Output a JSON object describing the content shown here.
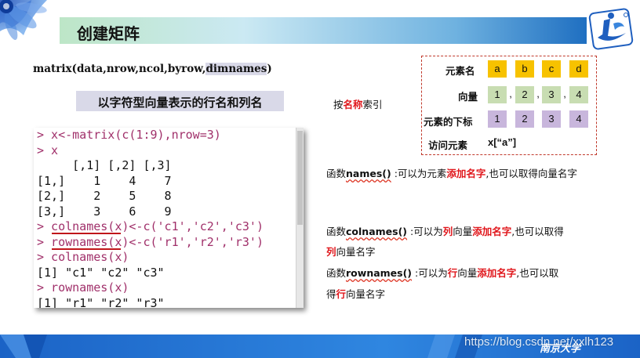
{
  "title": "创建矩阵",
  "matrix_signature": {
    "prefix": "matrix(data,nrow,ncol,byrow,",
    "highlight": "dimnames",
    "suffix": ")"
  },
  "subtitle": "以字符型向量表示的行名和列名",
  "by_name": {
    "prefix": "按",
    "highlight": "名称",
    "suffix": "索引"
  },
  "element_table": {
    "names_label": "元素名",
    "names": [
      "a",
      "b",
      "c",
      "d"
    ],
    "vector_label": "向量",
    "vector_values": [
      "1",
      "2",
      "3",
      "4"
    ],
    "separator": ",",
    "index_label": "元素的下标",
    "indices": [
      "1",
      "2",
      "3",
      "4"
    ],
    "access_label": "访问元素",
    "access_example": "x[“a”]"
  },
  "console_lines": [
    {
      "kind": "cmd",
      "text": "> x<-matrix(c(1:9),nrow=3)"
    },
    {
      "kind": "cmd",
      "text": "> x"
    },
    {
      "kind": "out",
      "text": "     [,1] [,2] [,3]"
    },
    {
      "kind": "out",
      "text": "[1,]    1    4    7"
    },
    {
      "kind": "out",
      "text": "[2,]    2    5    8"
    },
    {
      "kind": "out",
      "text": "[3,]    3    6    9"
    },
    {
      "kind": "cmd",
      "text": "> colnames(x)<-c('c1','c2','c3')"
    },
    {
      "kind": "cmd",
      "text": "> rownames(x)<-c('r1','r2','r3')"
    },
    {
      "kind": "cmd",
      "text": "> colnames(x)"
    },
    {
      "kind": "out",
      "text": "[1] \"c1\" \"c2\" \"c3\""
    },
    {
      "kind": "cmd",
      "text": "> rownames(x)"
    },
    {
      "kind": "out",
      "text": "[1] \"r1\" \"r2\" \"r3\""
    }
  ],
  "desc_names": {
    "p1": "函数",
    "fn": "names()",
    "p2": " :可以为元素",
    "red": "添加名字",
    "p3": ",也可以取得向量名字"
  },
  "desc_colnames": {
    "p1": "函数",
    "fn": "colnames()",
    "p2": " :可以为",
    "red1": "列",
    "p3": "向量",
    "red2": "添加名字",
    "p4": ",也可以取得",
    "l2_red": "列",
    "l2_rest": "向量名字"
  },
  "desc_rownames": {
    "p1": "函数",
    "fn": "rownames()",
    "p2": " :可以为",
    "red1": "行",
    "p3": "向量",
    "red2": "添加名字",
    "p4": ",也可以取",
    "l2_pre": "得",
    "l2_red": "行",
    "l2_rest": "向量名字"
  },
  "footer_text": "南京大学",
  "watermark": "https://blog.csdn.net/xxlh123",
  "colors": {
    "accent_red": "#e0161b",
    "title_gradient_end": "#1f6fc1",
    "name_cell": "#f7c200",
    "value_cell": "#c8ddb2",
    "index_cell": "#c8b6dc",
    "console_cmd": "#a0306a"
  },
  "icons": [
    "corner-flower-icon",
    "logo-icon"
  ]
}
